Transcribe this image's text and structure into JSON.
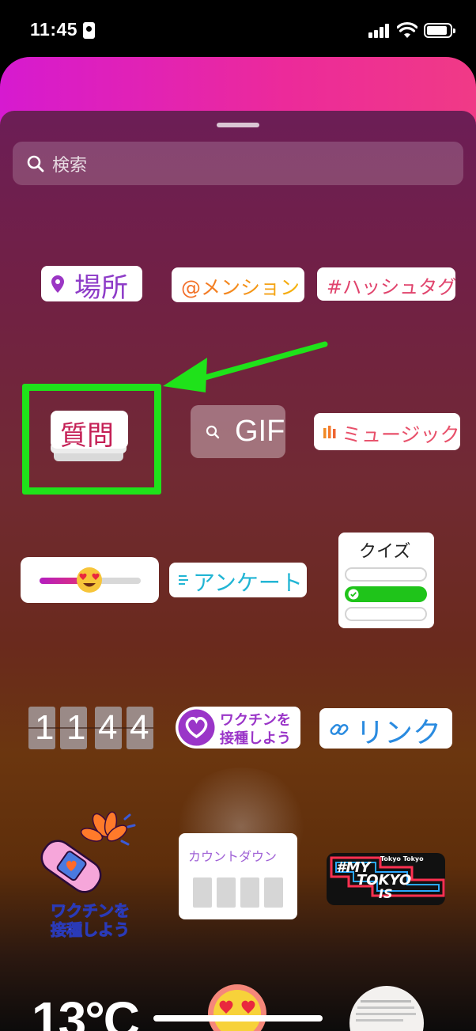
{
  "status": {
    "time": "11:45"
  },
  "search": {
    "placeholder": "検索"
  },
  "stickers": {
    "location": "場所",
    "mention": "@メンション",
    "hashtag": "#ハッシュタグ",
    "question": "質問",
    "gif": "GIF",
    "music": "ミュージック",
    "poll": "アンケート",
    "quiz": "クイズ",
    "countdown_digits": [
      "1",
      "1",
      "4",
      "4"
    ],
    "vaccine_badge_line1": "ワクチンを",
    "vaccine_badge_line2": "接種しよう",
    "link": "リンク",
    "vaccine_art_line1": "ワクチンを",
    "vaccine_art_line2": "接種しよう",
    "countdown": "カウントダウン",
    "tokyo_line1": "#MY",
    "tokyo_line2": "TOKYO",
    "tokyo_line3": "IS",
    "tokyo_tag": "Tokyo Tokyo",
    "temperature": "13°C"
  },
  "colors": {
    "highlight": "#1fe21a",
    "arrow": "#1fe21a",
    "question_text": "#c41f55",
    "link_text": "#2a8be0",
    "poll_text": "#22b5d4",
    "countdown_text": "#a062d6",
    "quiz_selected": "#1fc41a"
  },
  "icons": [
    "search-icon",
    "location-pin-icon",
    "music-bars-icon",
    "link-icon",
    "check-icon",
    "heart-eyes-emoji-icon"
  ]
}
